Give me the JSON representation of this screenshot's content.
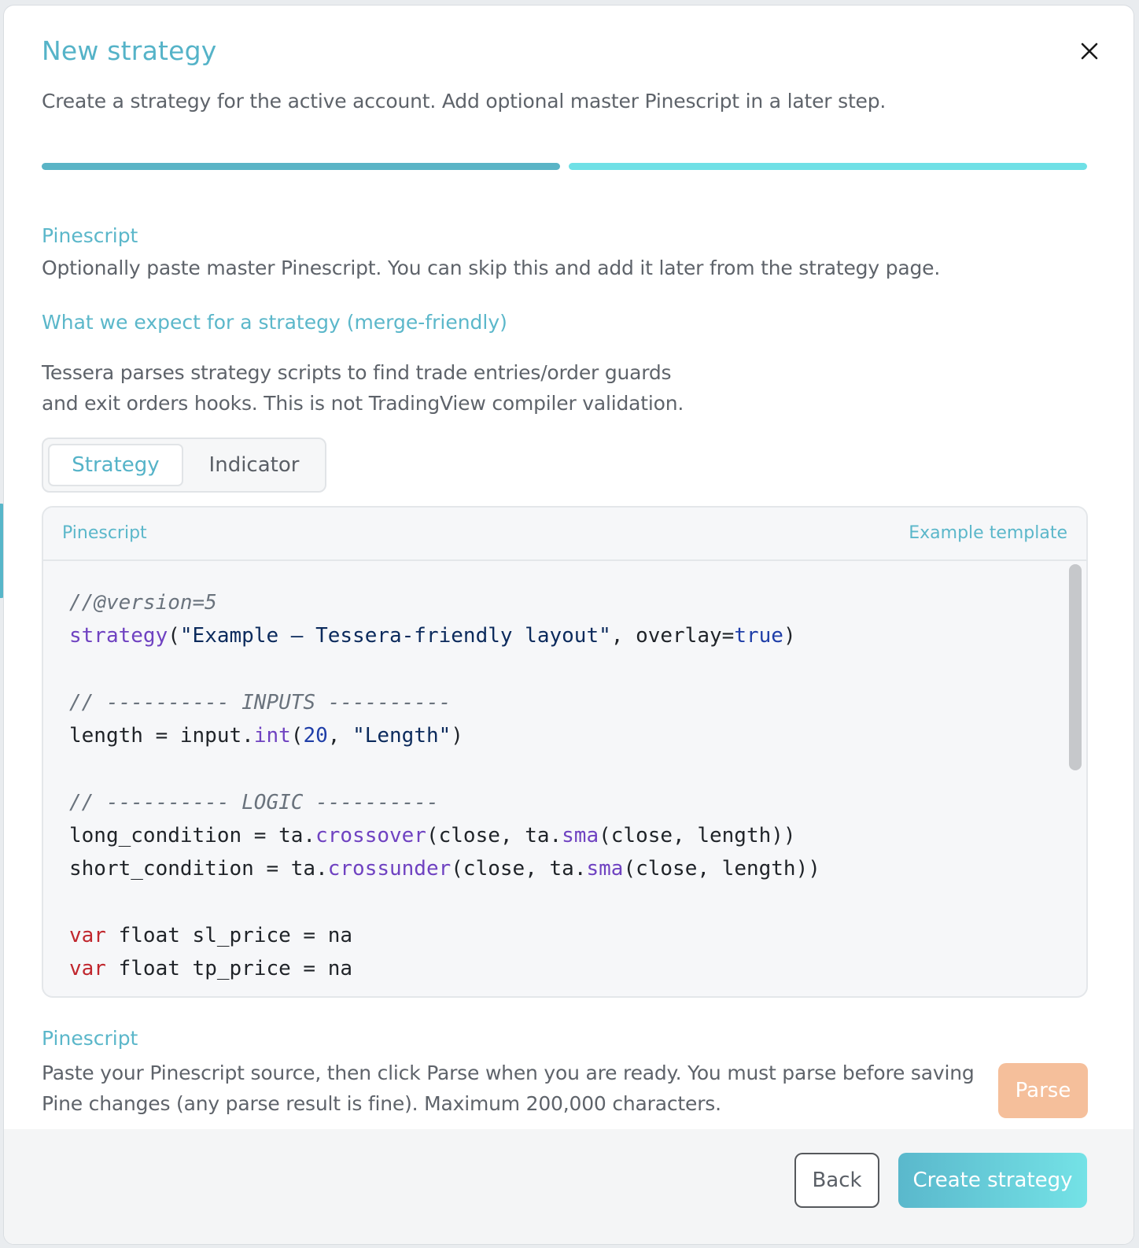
{
  "modal": {
    "title": "New strategy",
    "subtitle": "Create a strategy for the active account. Add optional master Pinescript in a later step.",
    "progress": {
      "current_step": 2,
      "total_steps": 2
    }
  },
  "pinescript_section": {
    "title": "Pinescript",
    "description": "Optionally paste master Pinescript. You can skip this and add it later from the strategy page."
  },
  "expectations": {
    "title": "What we expect for a strategy (merge-friendly)",
    "line1": "Tessera parses strategy scripts to find trade entries/order guards",
    "line2": "and exit orders hooks. This is not TradingView compiler validation."
  },
  "mode_toggle": {
    "options": [
      "Strategy",
      "Indicator"
    ],
    "selected": "Strategy"
  },
  "editor": {
    "label": "Pinescript",
    "example_link": "Example template",
    "lines": [
      "//@version=5",
      "strategy(\"Example — Tessera-friendly layout\", overlay=true)",
      "",
      "// ---------- INPUTS ----------",
      "length = input.int(20, \"Length\")",
      "",
      "// ---------- LOGIC ----------",
      "long_condition = ta.crossover(close, ta.sma(close, length))",
      "short_condition = ta.crossunder(close, ta.sma(close, length))",
      "",
      "var float sl_price = na",
      "var float tp_price = na"
    ]
  },
  "parse_section": {
    "title": "Pinescript",
    "line1": "Paste your Pinescript source, then click Parse when you are ready. You must parse before saving",
    "line2": "Pine changes (any parse result is fine). Maximum 200,000 characters.",
    "parse_label": "Parse"
  },
  "footer": {
    "back_label": "Back",
    "create_label": "Create strategy"
  },
  "colors": {
    "accent": "#55b3c8",
    "accent_light": "#6fe0e6",
    "parse_disabled": "#f5bf9b"
  },
  "icons": {
    "close": "close-icon"
  }
}
